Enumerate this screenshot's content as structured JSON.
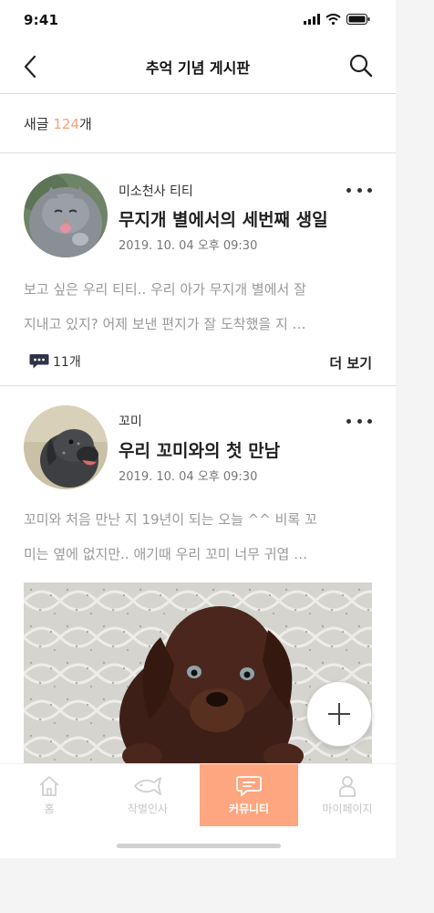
{
  "status": {
    "time": "9:41",
    "icons": [
      "signal-icon",
      "wifi-icon",
      "battery-icon"
    ]
  },
  "header": {
    "title": "추억 기념 게시판",
    "back_icon": "chevron-left-icon",
    "search_icon": "search-icon"
  },
  "summary": {
    "label": "새글 ",
    "count": "124",
    "suffix": "개"
  },
  "posts": [
    {
      "author": "미소천사 티티",
      "title": "무지개 별에서의 세번째 생일",
      "date": "2019. 10. 04 오후 09:30",
      "excerpt_lines": [
        "보고 싶은 우리 티티.. 우리 아가 무지개 별에서 잘",
        "지내고 있지? 어제 보낸 편지가 잘 도착했을 지 …"
      ],
      "comment_count": "11개",
      "more_label": "더 보기"
    },
    {
      "author": "꼬미",
      "title": "우리 꼬미와의 첫 만남",
      "date": "2019. 10. 04 오후 09:30",
      "excerpt_lines": [
        "꼬미와 처음 만난 지 19년이 되는 오늘 ^^ 비록 꼬",
        "미는 옆에 없지만.. 애기때 우리 꼬미 너무 귀엽 …"
      ]
    }
  ],
  "tabs": [
    {
      "label": "홈",
      "icon": "home-icon",
      "active": false
    },
    {
      "label": "작별인사",
      "icon": "fish-icon",
      "active": false
    },
    {
      "label": "커뮤니티",
      "icon": "chat-icon",
      "active": true
    },
    {
      "label": "마이페이지",
      "icon": "person-icon",
      "active": false
    }
  ],
  "colors": {
    "accent": "#fda67f",
    "count_accent": "#f4a07a",
    "text": "#222222",
    "muted": "#999999"
  }
}
